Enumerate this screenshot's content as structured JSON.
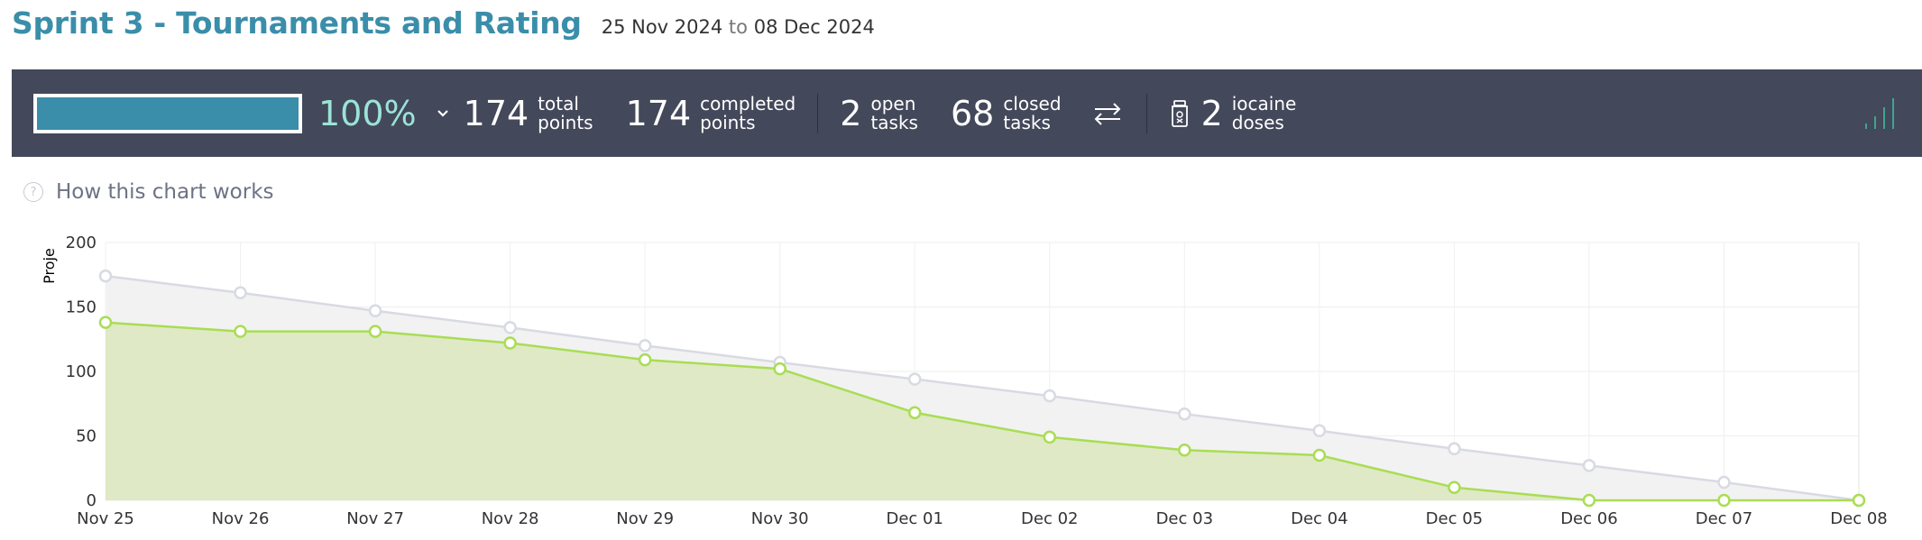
{
  "header": {
    "title": "Sprint 3 - Tournaments and Rating",
    "start_date": "25 Nov 2024",
    "to": "to",
    "end_date": "08 Dec 2024"
  },
  "summary": {
    "progress": 1.0,
    "percent_text": "100%",
    "total_points": {
      "value": "174",
      "label1": "total",
      "label2": "points"
    },
    "completed_points": {
      "value": "174",
      "label1": "completed",
      "label2": "points"
    },
    "open_tasks": {
      "value": "2",
      "label1": "open",
      "label2": "tasks"
    },
    "closed_tasks": {
      "value": "68",
      "label1": "closed",
      "label2": "tasks"
    },
    "iocaine": {
      "value": "2",
      "label1": "iocaine",
      "label2": "doses"
    },
    "colors": {
      "bar_bg": "#43485a",
      "progress": "#3a8eaa",
      "percent": "#9be3d7",
      "bars_icon": "#3fa58f"
    }
  },
  "help": {
    "label": "How this chart works",
    "icon": "?"
  },
  "chart_data": {
    "type": "area",
    "ylabel": "Proje",
    "ylim": [
      0,
      200
    ],
    "yticks": [
      0,
      50,
      100,
      150,
      200
    ],
    "categories": [
      "Nov 25",
      "Nov 26",
      "Nov 27",
      "Nov 28",
      "Nov 29",
      "Nov 30",
      "Dec 01",
      "Dec 02",
      "Dec 03",
      "Dec 04",
      "Dec 05",
      "Dec 06",
      "Dec 07",
      "Dec 08"
    ],
    "series": [
      {
        "values": [
          174,
          161,
          147,
          134,
          120,
          107,
          94,
          81,
          67,
          54,
          40,
          27,
          14,
          0
        ],
        "color": "#d8dae3",
        "fill": "#f2f2f2"
      },
      {
        "values": [
          138,
          131,
          131,
          122,
          109,
          102,
          68,
          49,
          39,
          35,
          10,
          0,
          0,
          0
        ],
        "color": "#a9dd54",
        "fill": "#dfe9c6"
      }
    ],
    "grid": true
  }
}
